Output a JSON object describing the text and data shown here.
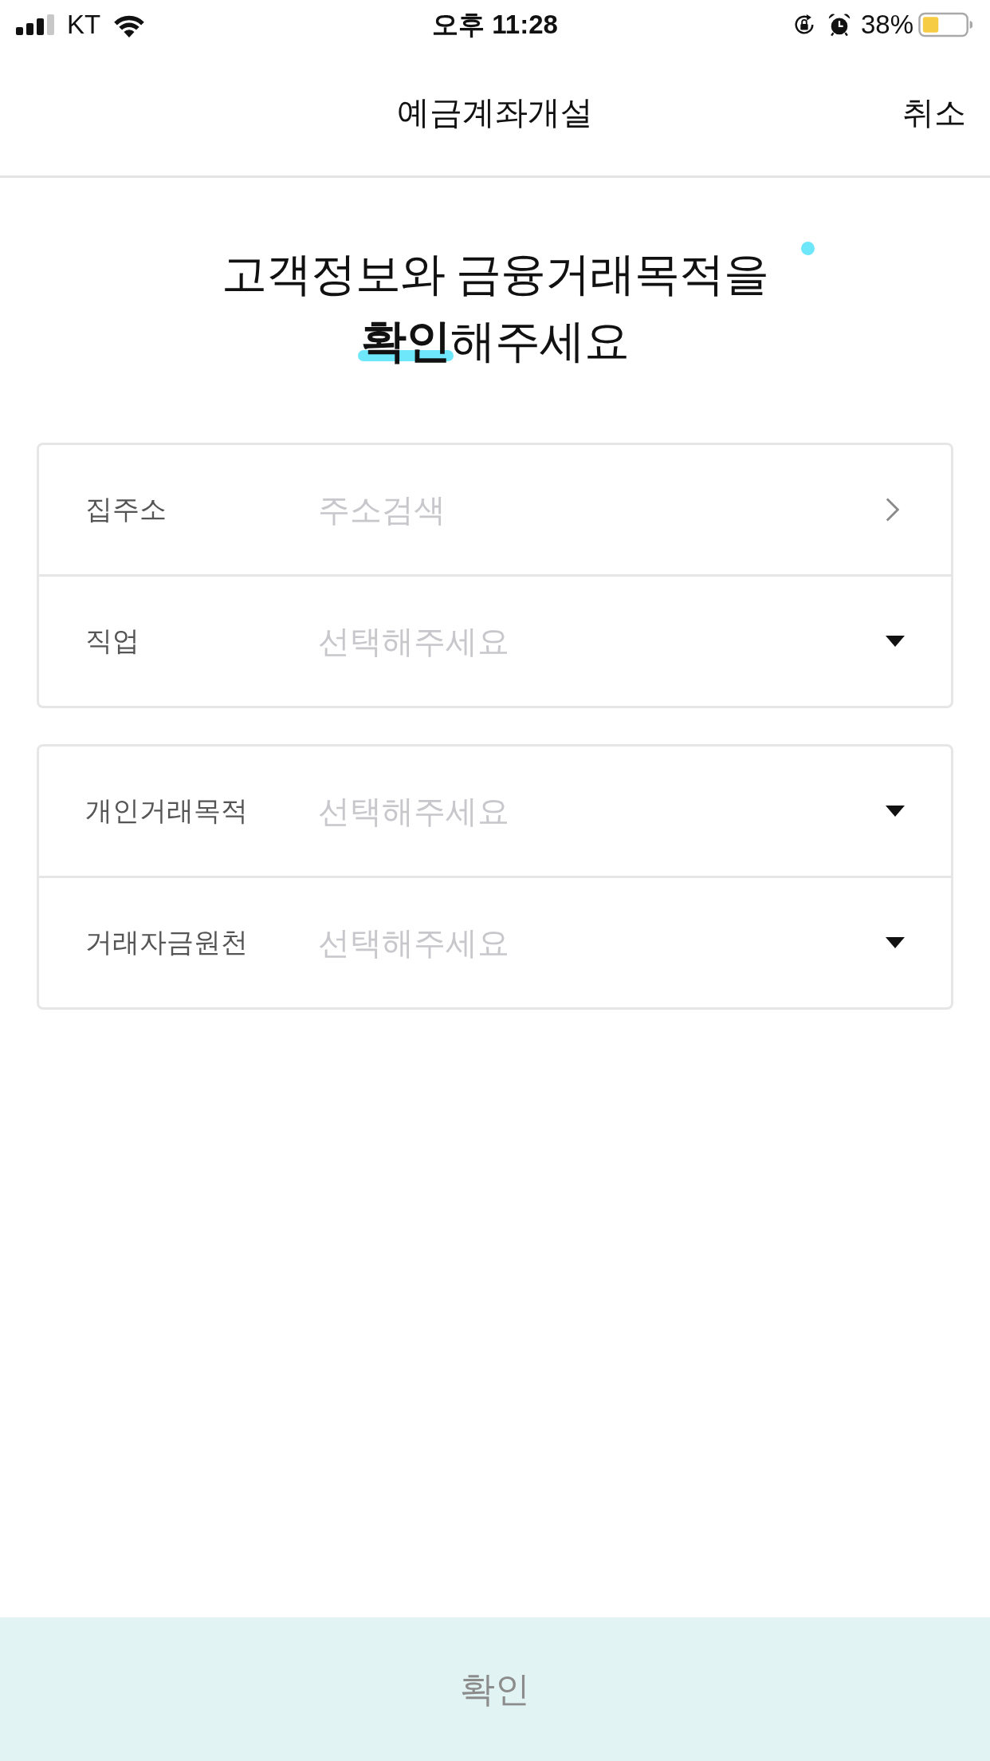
{
  "status_bar": {
    "carrier": "KT",
    "time": "오후 11:28",
    "battery": "38%"
  },
  "header": {
    "title": "예금계좌개설",
    "cancel_button": "취소"
  },
  "headline": "고객정보와 금융거래목적을 **확인**해주세요",
  "form_groups": [
    {
      "rows": [
        {
          "kind": "link",
          "label": "집주소",
          "placeholder": "주소검색"
        },
        {
          "kind": "select",
          "label": "직업",
          "placeholder": "선택해주세요"
        }
      ]
    },
    {
      "rows": [
        {
          "kind": "select",
          "label": "개인거래목적",
          "placeholder": "선택해주세요"
        },
        {
          "kind": "select",
          "label": "거래자금원천",
          "placeholder": "선택해주세요"
        }
      ]
    }
  ],
  "confirm_button": {
    "label": "확인",
    "disabled": true
  }
}
